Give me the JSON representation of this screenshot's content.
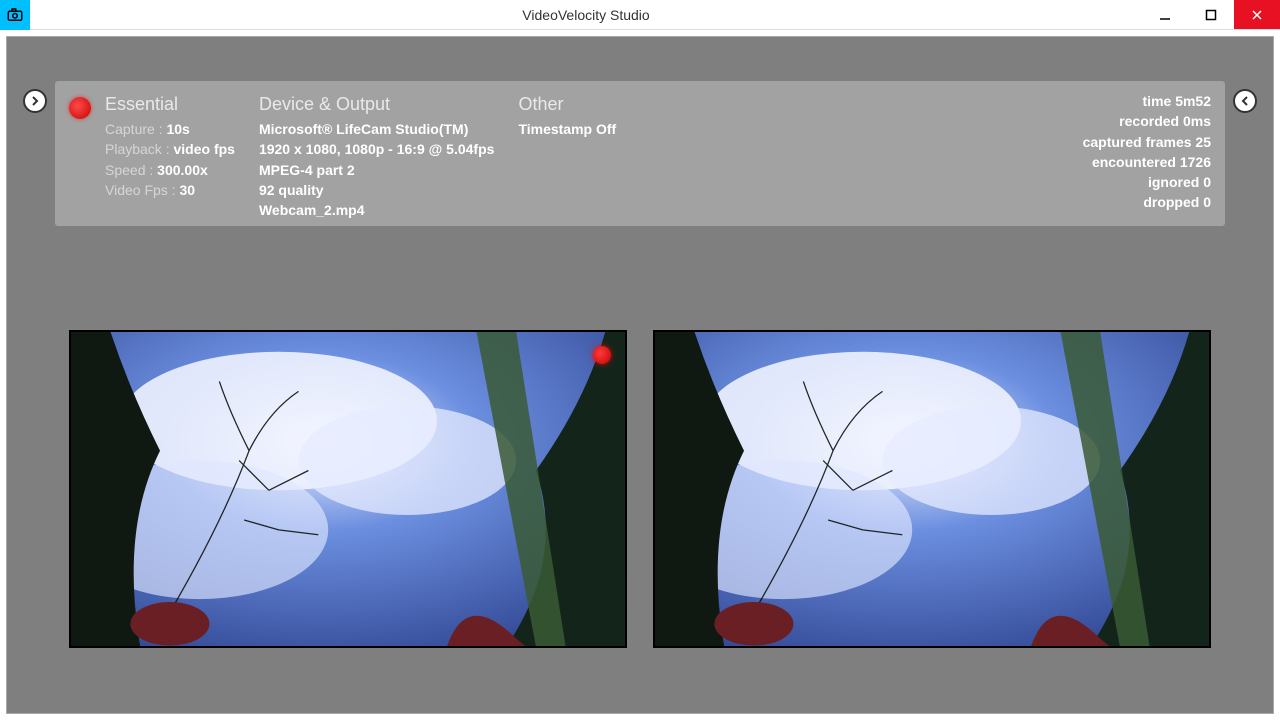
{
  "window": {
    "title": "VideoVelocity Studio"
  },
  "panel": {
    "essential": {
      "header": "Essential",
      "capture_label": "Capture : ",
      "capture_value": "10s",
      "playback_label": "Playback : ",
      "playback_value": "video fps",
      "speed_label": "Speed : ",
      "speed_value": "300.00x",
      "videofps_label": "Video Fps : ",
      "videofps_value": "30"
    },
    "device": {
      "header": "Device & Output",
      "line1": "Microsoft® LifeCam Studio(TM)",
      "line2": "1920 x 1080, 1080p - 16:9 @ 5.04fps",
      "line3": "MPEG-4 part 2",
      "line4": "92 quality",
      "line5": "Webcam_2.mp4"
    },
    "other": {
      "header": "Other",
      "line1": "Timestamp Off"
    },
    "stats": {
      "time": "time 5m52",
      "recorded": "recorded 0ms",
      "captured": "captured frames 25",
      "encountered": "encountered 1726",
      "ignored": "ignored 0",
      "dropped": "dropped 0"
    }
  }
}
